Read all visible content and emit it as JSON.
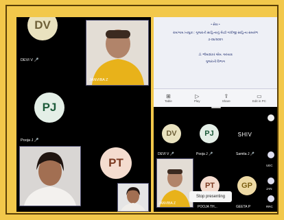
{
  "left": {
    "dv": {
      "initials": "DV",
      "name": "DEVI V 🎤"
    },
    "pj": {
      "initials": "PJ",
      "name": "Pooja J 🎤"
    },
    "pt": {
      "initials": "PT"
    },
    "speaker": {
      "name": "JANVIBA Z"
    }
  },
  "document": {
    "line1": "• સેવા •",
    "line2": "રામ/ગામ /તાલુકા : ગુજરાતી સાહિત્યનું શ્રેષ્ઠી ગાંધીજી સાહિત્ય સમારંભ",
    "line3": "૭-૦૪/૨૦૨૧",
    "line4": "ડૉ. ભીમાશંકર એમ. અધ્યક્ષ",
    "line5": "ગુજરાતી વિભાગ",
    "toolbar": [
      "Table",
      "Play",
      "Share",
      "Edit in PC"
    ]
  },
  "right": {
    "dv": {
      "initials": "DV",
      "name": "DEVI V 🎤"
    },
    "pj": {
      "initials": "PJ",
      "name": "Pooja J 🎤"
    },
    "shiv": {
      "logo": "SHIV",
      "name": "Samita J 🎤"
    },
    "pt": {
      "initials": "PT",
      "name": "POOJA TH..."
    },
    "gp": {
      "initials": "GP",
      "name": "GEETA P"
    },
    "speaker": {
      "name": "JANVIBA Z"
    },
    "side_labels": [
      "UEC",
      "JAN",
      "RRC"
    ]
  },
  "stop_presenting": "Stop presenting"
}
